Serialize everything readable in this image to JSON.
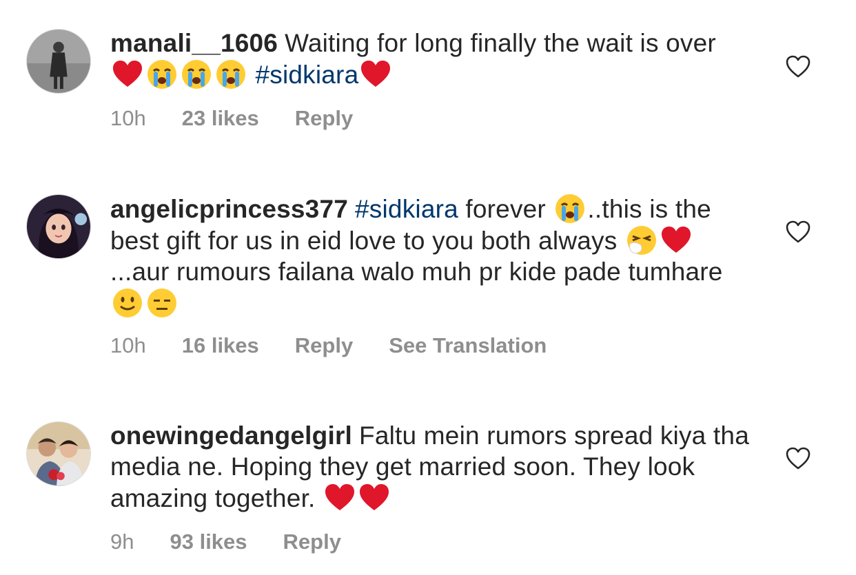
{
  "comments": [
    {
      "username": "manali__1606",
      "text_parts": [
        "Waiting for long finally the wait is over ",
        "#sidkiara"
      ],
      "time": "10h",
      "likes": "23 likes",
      "reply": "Reply",
      "avatar_icon": "woman-standing-avatar"
    },
    {
      "username": "angelicprincess377",
      "text_parts": [
        "#sidkiara",
        " forever ",
        "..this is the best gift for us in eid love to you both always ",
        "...aur rumours failana walo muh pr kide pade tumhare"
      ],
      "time": "10h",
      "likes": "16 likes",
      "reply": "Reply",
      "translate": "See Translation",
      "avatar_icon": "cartoon-girl-avatar"
    },
    {
      "username": "onewingedangelgirl",
      "text_parts": [
        "Faltu mein rumors spread kiya tha media ne. Hoping they get married soon. They look amazing together. "
      ],
      "time": "9h",
      "likes": "93 likes",
      "reply": "Reply",
      "avatar_icon": "couple-photo-avatar"
    }
  ],
  "colors": {
    "hashtag": "#00376b",
    "meta": "#8e8e8e",
    "text": "#262626",
    "heart_emoji": "#e0162b"
  }
}
